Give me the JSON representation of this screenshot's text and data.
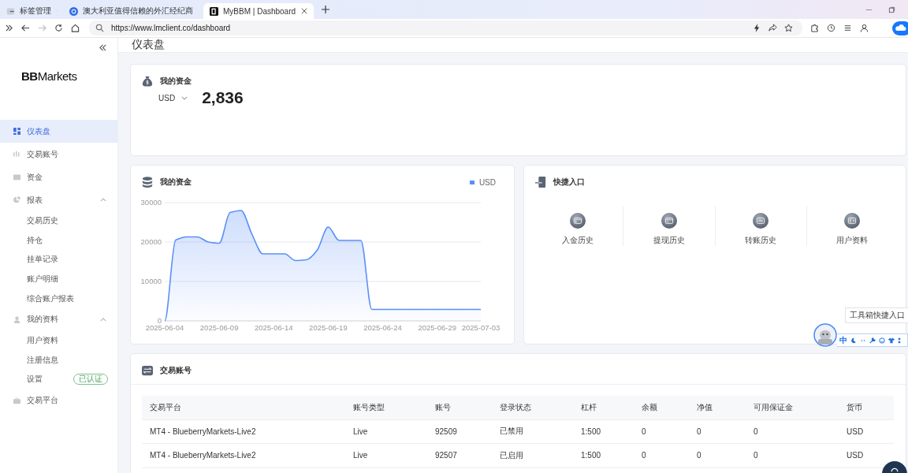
{
  "browser": {
    "tabs": [
      {
        "label": "标签管理",
        "kind": "group",
        "selected": false
      },
      {
        "label": "澳大利亚值得信赖的外汇经纪商",
        "kind": "site",
        "selected": false
      },
      {
        "label": "MyBBM | Dashboard",
        "kind": "site",
        "selected": true
      }
    ],
    "url": "https://www.lmclient.co/dashboard"
  },
  "sidebar": {
    "logo": "**BB**Markets",
    "items": [
      {
        "label": "仪表盘",
        "kind": "dashboard",
        "selected": true
      },
      {
        "label": "交易账号",
        "kind": "bars",
        "selected": false
      },
      {
        "label": "资金",
        "kind": "wallet",
        "selected": false
      },
      {
        "label": "报表",
        "kind": "pie",
        "selected": false,
        "expanded": true,
        "children": [
          {
            "label": "交易历史"
          },
          {
            "label": "持仓"
          },
          {
            "label": "挂单记录"
          },
          {
            "label": "账户明细"
          },
          {
            "label": "综合账户报表"
          }
        ]
      },
      {
        "label": "我的资料",
        "kind": "user",
        "selected": false,
        "expanded": true,
        "children": [
          {
            "label": "用户资料"
          },
          {
            "label": "注册信息"
          },
          {
            "label": "设置",
            "badge": "已认证"
          }
        ]
      },
      {
        "label": "交易平台",
        "kind": "case",
        "selected": false
      }
    ]
  },
  "header": {
    "title": "仪表盘"
  },
  "balance": {
    "title": "我的资金",
    "currency": "USD",
    "amount": "2,836"
  },
  "funds_chart": {
    "title": "我的资金",
    "chart_data": {
      "type": "area",
      "categories": [
        "2025-06-04",
        null,
        null,
        null,
        null,
        "2025-06-09",
        null,
        null,
        null,
        null,
        "2025-06-14",
        null,
        null,
        null,
        null,
        "2025-06-19",
        null,
        null,
        null,
        null,
        "2025-06-24",
        null,
        null,
        null,
        null,
        "2025-06-29",
        null,
        null,
        null,
        "2025-07-03"
      ],
      "series": [
        {
          "name": "USD",
          "color": "#5b8ff9",
          "values": [
            0,
            20500,
            21300,
            21300,
            20000,
            19700,
            27500,
            28000,
            22000,
            17000,
            17000,
            17000,
            15300,
            15500,
            18000,
            23800,
            20400,
            20400,
            20400,
            2900,
            2900,
            2900,
            2900,
            2900,
            2900,
            2900,
            2900,
            2900,
            2900,
            2900
          ]
        }
      ],
      "ylim": [
        0,
        30000
      ],
      "yticks": [
        0,
        10000,
        20000,
        30000
      ]
    }
  },
  "quick_links": {
    "title": "快捷入口",
    "items": [
      {
        "label": "入金历史",
        "kind": "deposit"
      },
      {
        "label": "提现历史",
        "kind": "withdraw"
      },
      {
        "label": "转账历史",
        "kind": "transfer"
      },
      {
        "label": "用户资料",
        "kind": "profile"
      }
    ]
  },
  "accounts": {
    "title": "交易账号",
    "columns": [
      "交易平台",
      "账号类型",
      "账号",
      "登录状态",
      "杠杆",
      "余额",
      "净值",
      "可用保证金",
      "货币"
    ],
    "rows": [
      [
        "MT4 - BlueberryMarkets-Live2",
        "Live",
        "92509",
        "已禁用",
        "1:500",
        "0",
        "0",
        "0",
        "USD"
      ],
      [
        "MT4 - BlueberryMarkets-Live2",
        "Live",
        "92507",
        "已启用",
        "1:500",
        "0",
        "0",
        "0",
        "USD"
      ]
    ]
  },
  "ime_toolbar": {
    "tooltip": "工具箱快捷入口",
    "mode": "中"
  }
}
